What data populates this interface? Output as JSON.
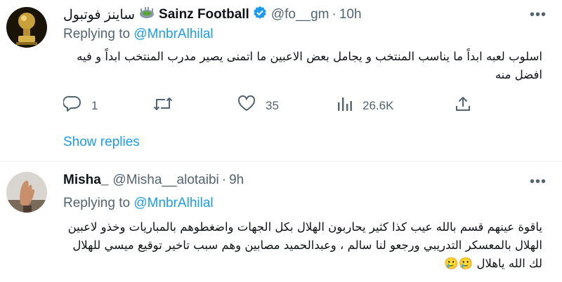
{
  "tweet1": {
    "display_name": "Sainz Football",
    "arabic_name": "ساينز فوتبول",
    "handle": "@fo__gm",
    "separator": "·",
    "time": "10h",
    "replying_prefix": "Replying to",
    "replying_to": "@MnbrAlhilal",
    "text": "اسلوب لعبه ابداً ما يناسب المنتخب و يجامل بعض الاعبين ما اتمنى يصير  مدرب المنتخب ابداً و فيه افضل منه",
    "replies": "1",
    "retweets": "",
    "likes": "35",
    "views": "26.6K",
    "show_replies": "Show replies"
  },
  "tweet2": {
    "display_name": "Misha_",
    "handle": "@Misha__alotaibi",
    "separator": "·",
    "time": "9h",
    "replying_prefix": "Replying to",
    "replying_to": "@MnbrAlhilal",
    "text": "ياقوة عينهم قسم  بالله عيب كذا كثير يحاربون الهلال بكل الجهات واضغطوهم بالمباريات وخذو لاعبين الهلال بالمعسكر التدريبي ورجعو لنا سالم ، وعبدالحميد مصابين وهم سبب تاخير توقيع ميسي للهلال لك الله ياهلال 🥲🥲"
  },
  "icons": {
    "more": "more-icon",
    "verified": "verified-badge-icon",
    "stadium": "stadium-emoji-icon",
    "reply": "reply-icon",
    "retweet": "retweet-icon",
    "like": "like-icon",
    "views": "views-icon",
    "share": "share-icon"
  },
  "colors": {
    "accent": "#1d9bf0",
    "secondary_text": "#536471",
    "primary_text": "#0f1419",
    "divider": "#eff3f4"
  }
}
